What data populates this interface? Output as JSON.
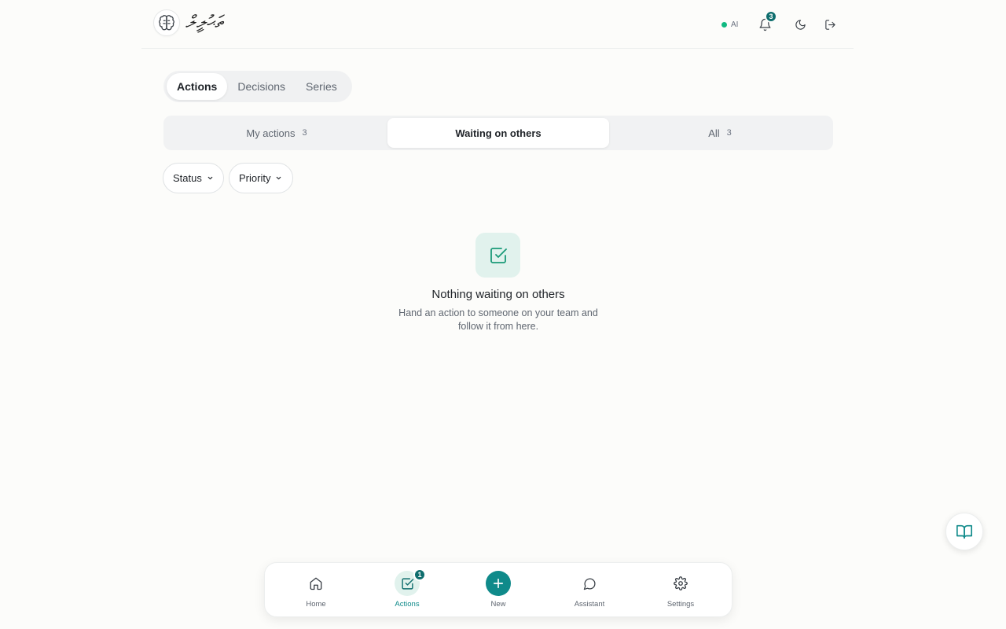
{
  "colors": {
    "accent": "#0f8a8a",
    "ai_status": "#10b981",
    "badge": "#0f6e6e",
    "empty_icon": "#1a9a78"
  },
  "header": {
    "logo_icon": "brain-icon",
    "logo_text": "ތަޙުލީލް",
    "ai_label": "AI",
    "notifications_count": "3",
    "icons": [
      "bell-icon",
      "moon-icon",
      "logout-icon"
    ]
  },
  "main_tabs": [
    {
      "label": "Actions",
      "active": true
    },
    {
      "label": "Decisions",
      "active": false
    },
    {
      "label": "Series",
      "active": false
    }
  ],
  "segments": [
    {
      "label": "My actions",
      "count": "3",
      "active": false
    },
    {
      "label": "Waiting on others",
      "count": "",
      "active": true
    },
    {
      "label": "All",
      "count": "3",
      "active": false
    }
  ],
  "filters": {
    "status": "Status",
    "priority": "Priority"
  },
  "empty_state": {
    "icon": "check-square-icon",
    "title": "Nothing waiting on others",
    "description": "Hand an action to someone on your team and follow it from here."
  },
  "floating_button_icon": "book-icon",
  "bottom_nav": [
    {
      "label": "Home",
      "icon": "home-icon"
    },
    {
      "label": "Actions",
      "icon": "check-square-icon",
      "badge": "1",
      "active": true
    },
    {
      "label": "New",
      "icon": "plus-icon"
    },
    {
      "label": "Assistant",
      "icon": "chat-icon"
    },
    {
      "label": "Settings",
      "icon": "gear-icon"
    }
  ]
}
